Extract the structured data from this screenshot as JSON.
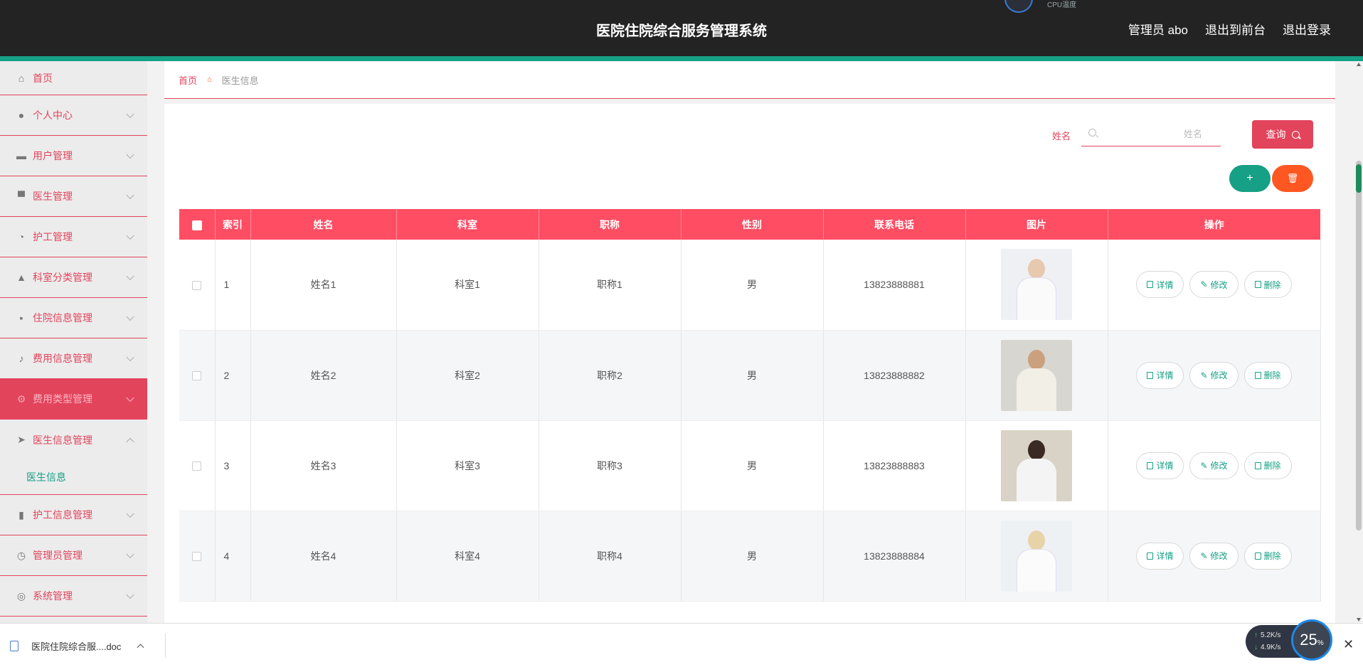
{
  "header": {
    "title": "医院住院综合服务管理系统",
    "admin_label": "管理员 abo",
    "back_label": "退出到前台",
    "logout_label": "退出登录",
    "cpu_label": "CPU温度"
  },
  "sidebar": {
    "items": [
      {
        "label": "首页",
        "icon": "home-icon"
      },
      {
        "label": "个人中心",
        "icon": "user-icon"
      },
      {
        "label": "用户管理",
        "icon": "ticket-icon"
      },
      {
        "label": "医生管理",
        "icon": "monitor-icon"
      },
      {
        "label": "护工管理",
        "icon": "gauge-icon"
      },
      {
        "label": "科室分类管理",
        "icon": "person-icon"
      },
      {
        "label": "住院信息管理",
        "icon": "chat-icon"
      },
      {
        "label": "费用信息管理",
        "icon": "mic-icon"
      },
      {
        "label": "费用类型管理",
        "icon": "settings-icon"
      },
      {
        "label": "医生信息管理",
        "icon": "send-icon"
      },
      {
        "label": "护工信息管理",
        "icon": "bar-chart-icon"
      },
      {
        "label": "管理员管理",
        "icon": "clock-icon"
      },
      {
        "label": "系统管理",
        "icon": "lifebuoy-icon"
      }
    ],
    "submenu": {
      "label": "医生信息"
    }
  },
  "breadcrumb": {
    "home": "首页",
    "current": "医生信息"
  },
  "search": {
    "label": "姓名",
    "placeholder": "姓名",
    "value": "",
    "button": "查询"
  },
  "actions": {
    "add": "+",
    "delete_icon": "trash-icon"
  },
  "table": {
    "columns": [
      "索引",
      "姓名",
      "科室",
      "职称",
      "性别",
      "联系电话",
      "图片",
      "操作"
    ],
    "rows": [
      {
        "index": "1",
        "name": "姓名1",
        "dept": "科室1",
        "title": "职称1",
        "gender": "男",
        "phone": "13823888881"
      },
      {
        "index": "2",
        "name": "姓名2",
        "dept": "科室2",
        "title": "职称2",
        "gender": "男",
        "phone": "13823888882"
      },
      {
        "index": "3",
        "name": "姓名3",
        "dept": "科室3",
        "title": "职称3",
        "gender": "男",
        "phone": "13823888883"
      },
      {
        "index": "4",
        "name": "姓名4",
        "dept": "科室4",
        "title": "职称4",
        "gender": "男",
        "phone": "13823888884"
      }
    ],
    "row_actions": {
      "detail": "详情",
      "edit": "修改",
      "delete": "删除"
    }
  },
  "download_bar": {
    "filename": "医院住院综合服....doc"
  },
  "net_widget": {
    "up": "5.2",
    "down": "4.9",
    "unit": "K/s",
    "percent": "25",
    "percent_sign": "%"
  },
  "colors": {
    "primary": "#e2445c",
    "header_bg": "#232323",
    "accent": "#16a085",
    "danger": "#ff5722",
    "table_header": "#ff4d63"
  }
}
